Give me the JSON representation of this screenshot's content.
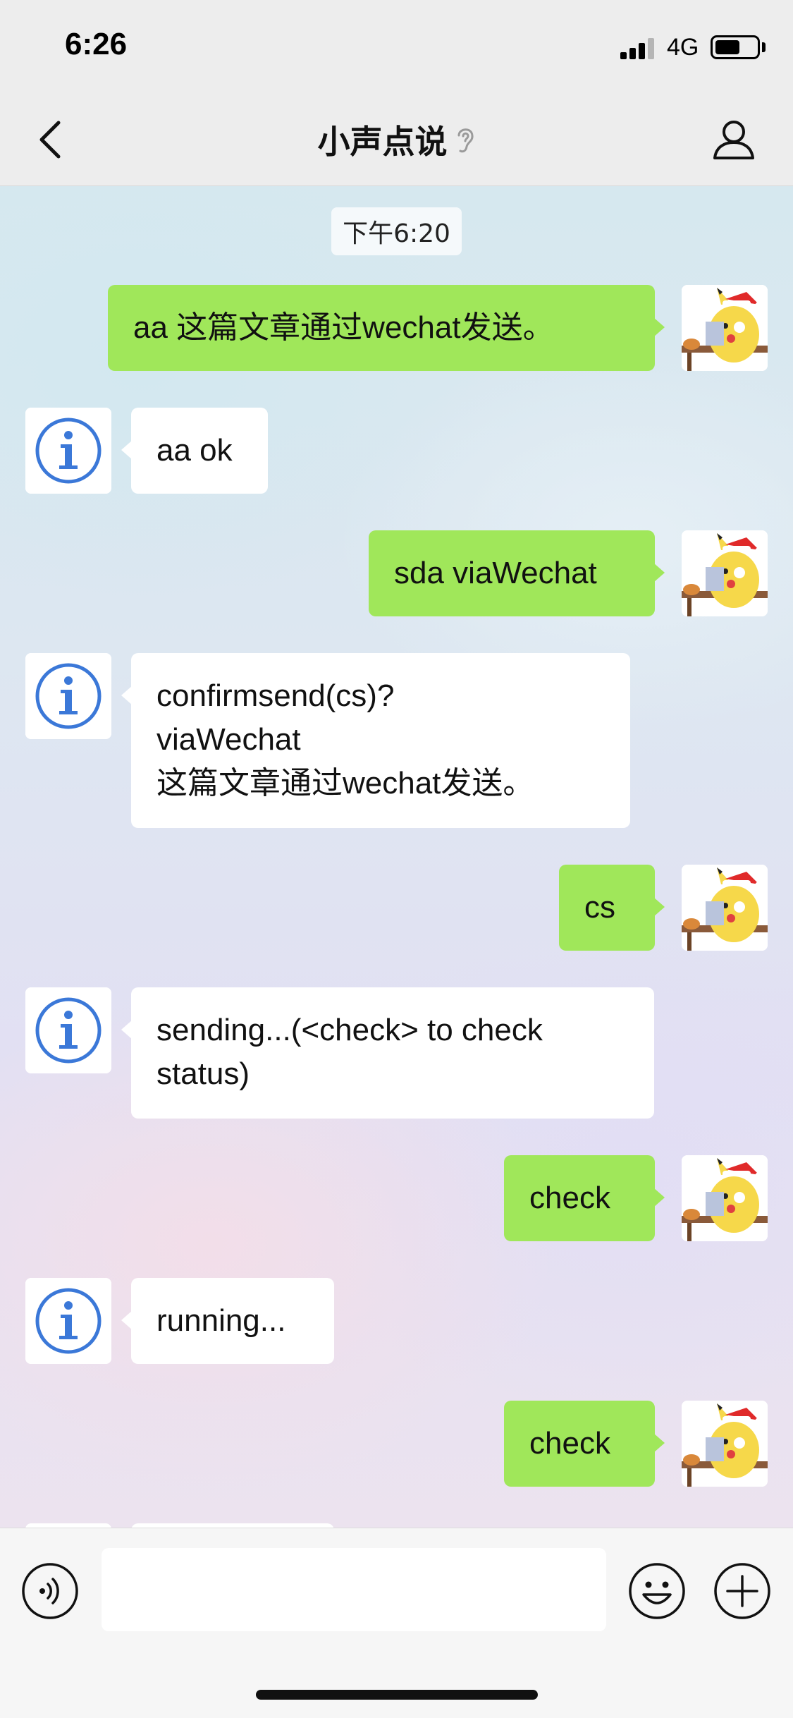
{
  "status_bar": {
    "time": "6:26",
    "network": "4G",
    "signal_bars": 3,
    "battery_level": 0.6
  },
  "nav": {
    "title": "小声点说",
    "back_icon": "chevron-left-icon",
    "title_icon": "ear-icon",
    "profile_icon": "person-icon"
  },
  "chat": {
    "time_divider": "下午6:20",
    "messages": [
      {
        "side": "sent",
        "text": "aa 这篇文章通过wechat发送。"
      },
      {
        "side": "received",
        "text": "aa ok"
      },
      {
        "side": "sent",
        "text": "sda viaWechat"
      },
      {
        "side": "received",
        "text": "confirmsend(cs)?\nviaWechat\n这篇文章通过wechat发送。"
      },
      {
        "side": "sent",
        "text": "cs"
      },
      {
        "side": "received",
        "text": "sending...(<check> to check\nstatus)"
      },
      {
        "side": "sent",
        "text": "check"
      },
      {
        "side": "received",
        "text": "running..."
      },
      {
        "side": "sent",
        "text": "check"
      }
    ]
  },
  "input_bar": {
    "voice_icon": "voice-icon",
    "message_value": "",
    "emoji_icon": "smiley-icon",
    "plus_icon": "plus-icon"
  },
  "colors": {
    "sent_bubble": "#a0e75a",
    "received_bubble": "#ffffff",
    "info_icon": "#3b78d8"
  }
}
